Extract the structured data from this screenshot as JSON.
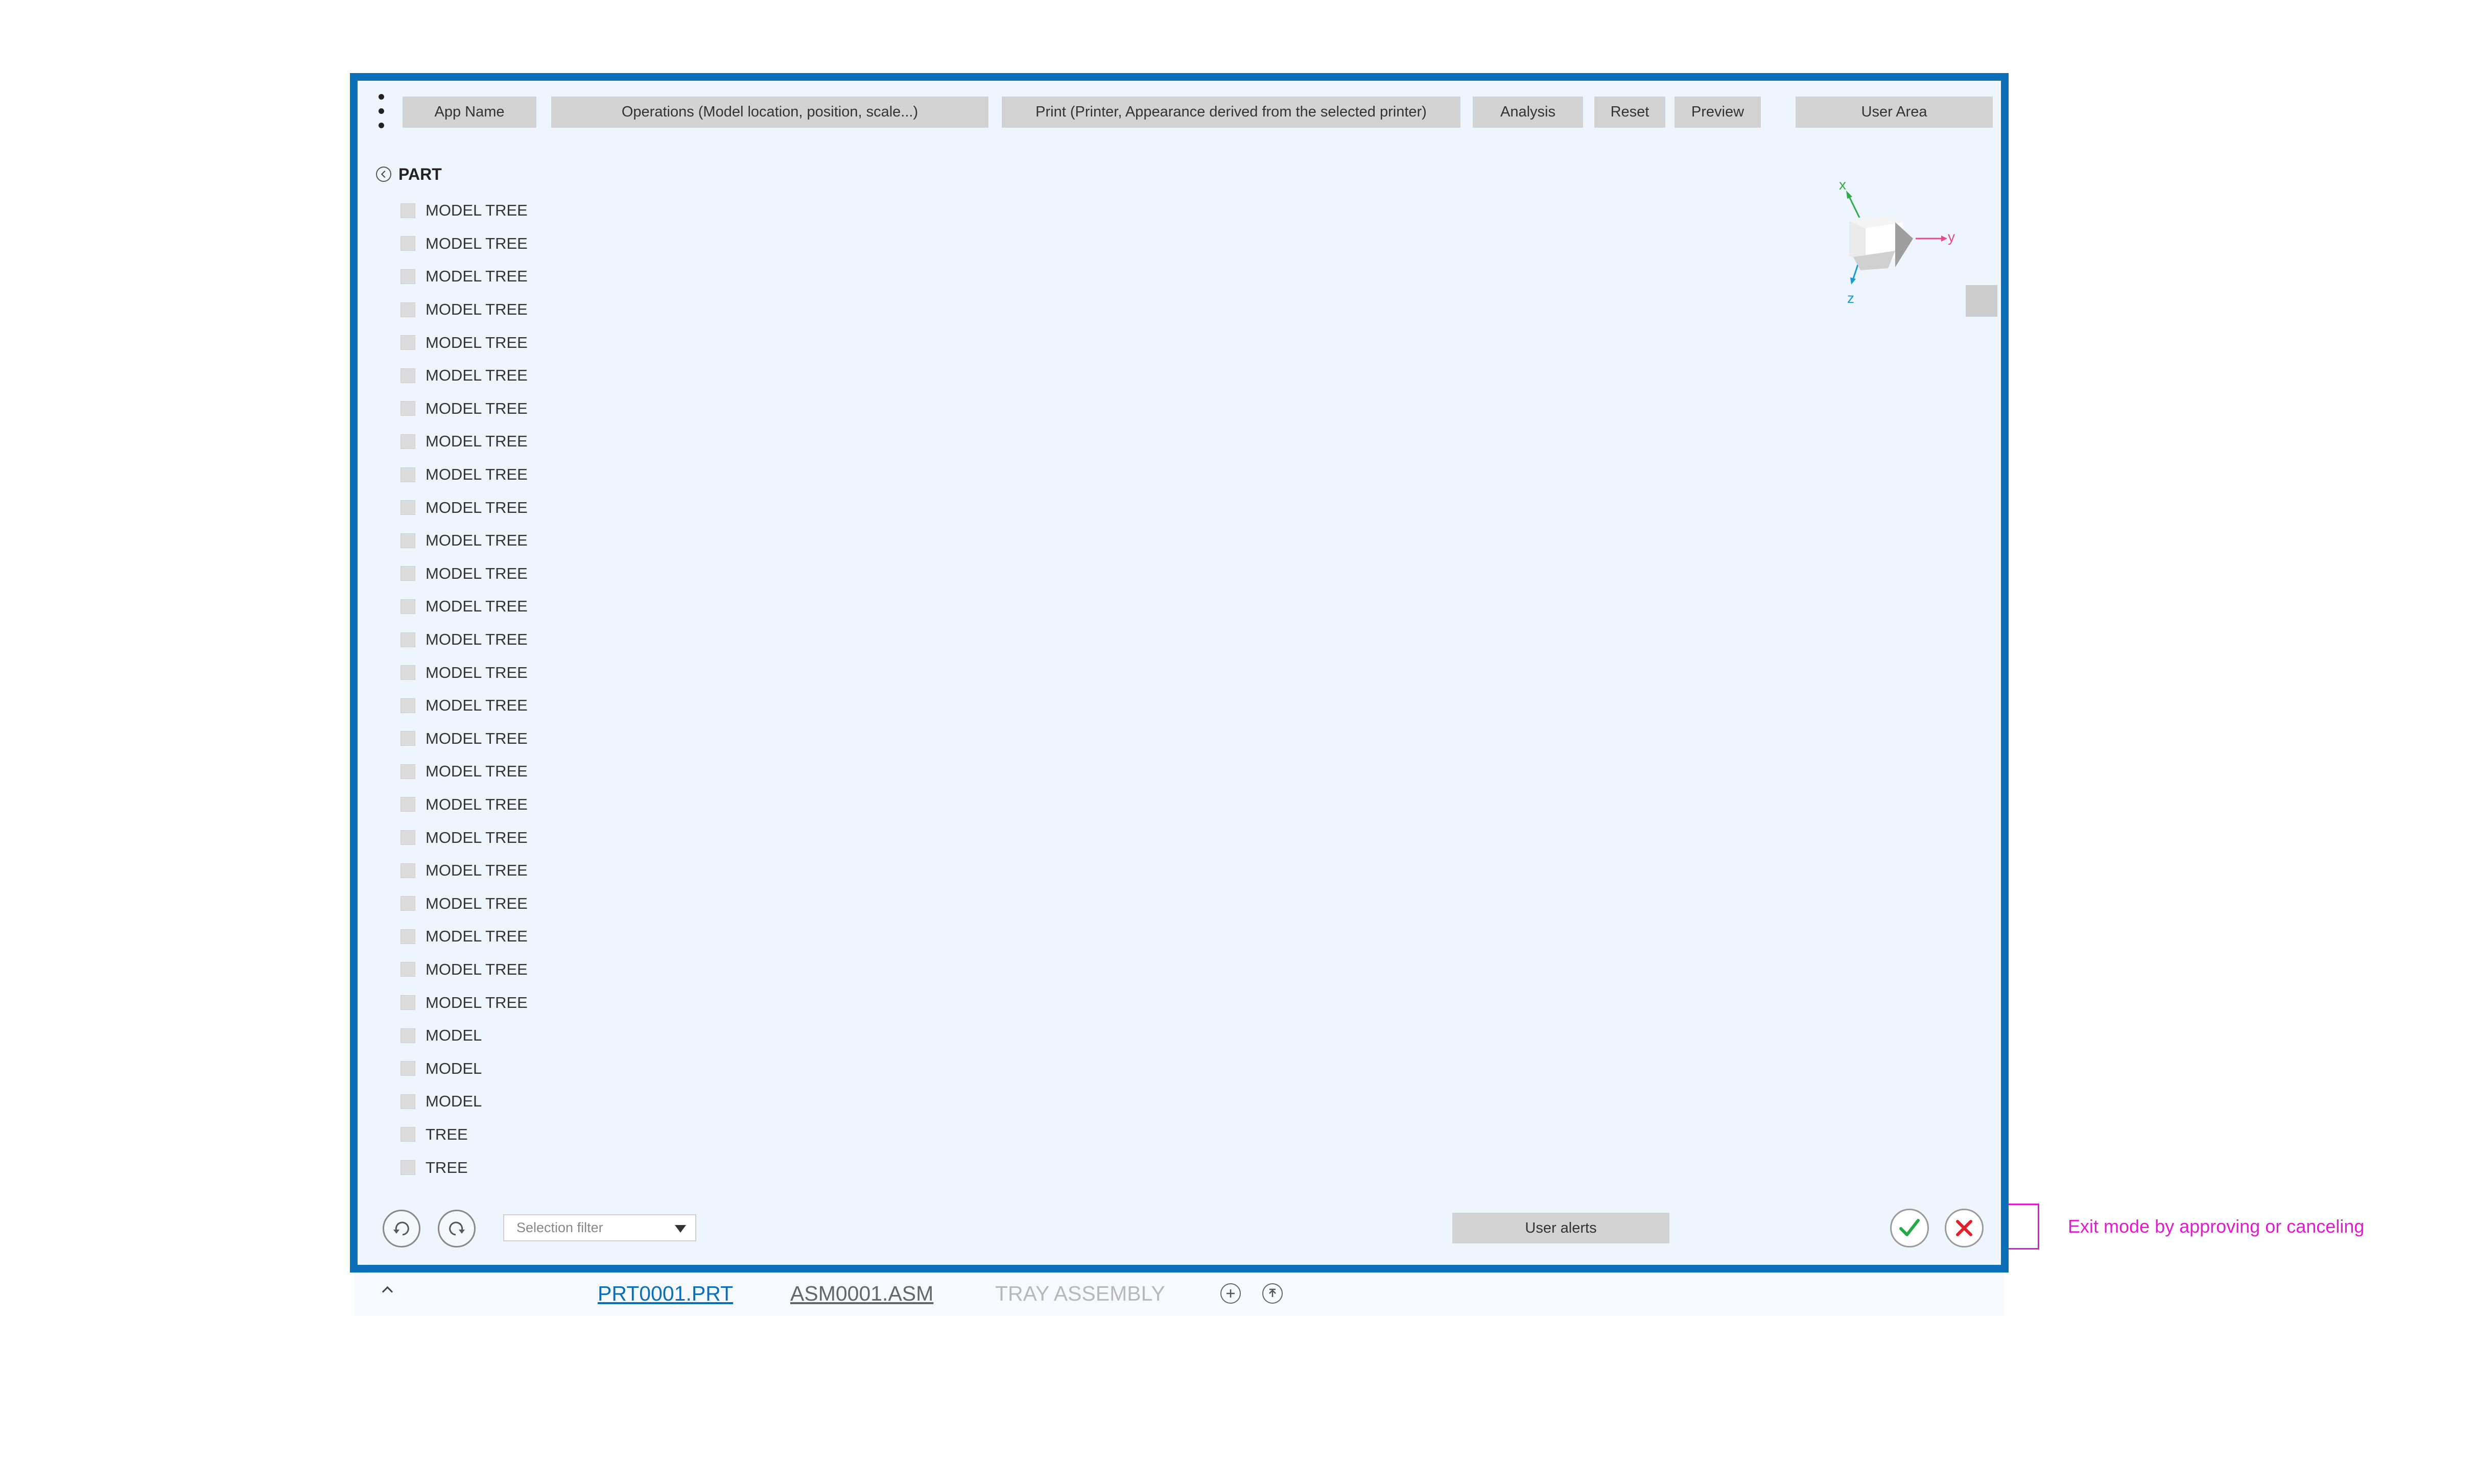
{
  "toolbar": {
    "app_name": "App Name",
    "operations": "Operations (Model location, position, scale...)",
    "print": "Print (Printer, Appearance derived from the selected printer)",
    "analysis": "Analysis",
    "reset": "Reset",
    "preview": "Preview",
    "user_area": "User Area"
  },
  "tree": {
    "title": "PART",
    "items": [
      "MODEL TREE",
      "MODEL TREE",
      "MODEL TREE",
      "MODEL TREE",
      "MODEL TREE",
      "MODEL TREE",
      "MODEL TREE",
      "MODEL TREE",
      "MODEL TREE",
      "MODEL TREE",
      "MODEL TREE",
      "MODEL TREE",
      "MODEL TREE",
      "MODEL TREE",
      "MODEL TREE",
      "MODEL TREE",
      "MODEL TREE",
      "MODEL TREE",
      "MODEL TREE",
      "MODEL TREE",
      "MODEL TREE",
      "MODEL TREE",
      "MODEL TREE",
      "MODEL TREE",
      "MODEL TREE",
      "MODEL",
      "MODEL",
      "MODEL",
      "TREE",
      "TREE"
    ]
  },
  "triad": {
    "x_label": "x",
    "y_label": "y",
    "z_label": "z",
    "x_color": "#2eaa4a",
    "y_color": "#e64a8c",
    "z_color": "#1a9ad6"
  },
  "bottom_bar": {
    "selection_filter_placeholder": "Selection filter",
    "user_alerts": "User alerts"
  },
  "annotation": {
    "text": "Exit mode by approving or canceling",
    "color": "#e21bd0"
  },
  "doc_tabs": [
    {
      "label": "PRT0001.PRT",
      "state": "active"
    },
    {
      "label": "ASM0001.ASM",
      "state": "normal"
    },
    {
      "label": "TRAY ASSEMBLY",
      "state": "dim"
    }
  ],
  "colors": {
    "frame": "#0a6fb8",
    "approve": "#27a84a",
    "cancel": "#e0202a"
  },
  "icons": {
    "menu": "kebab-menu-icon",
    "back": "chevron-left-circle-icon",
    "undo": "undo-icon",
    "redo": "redo-icon",
    "approve": "checkmark-icon",
    "cancel": "close-icon",
    "add": "plus-circle-icon",
    "upload": "upload-circle-icon"
  }
}
